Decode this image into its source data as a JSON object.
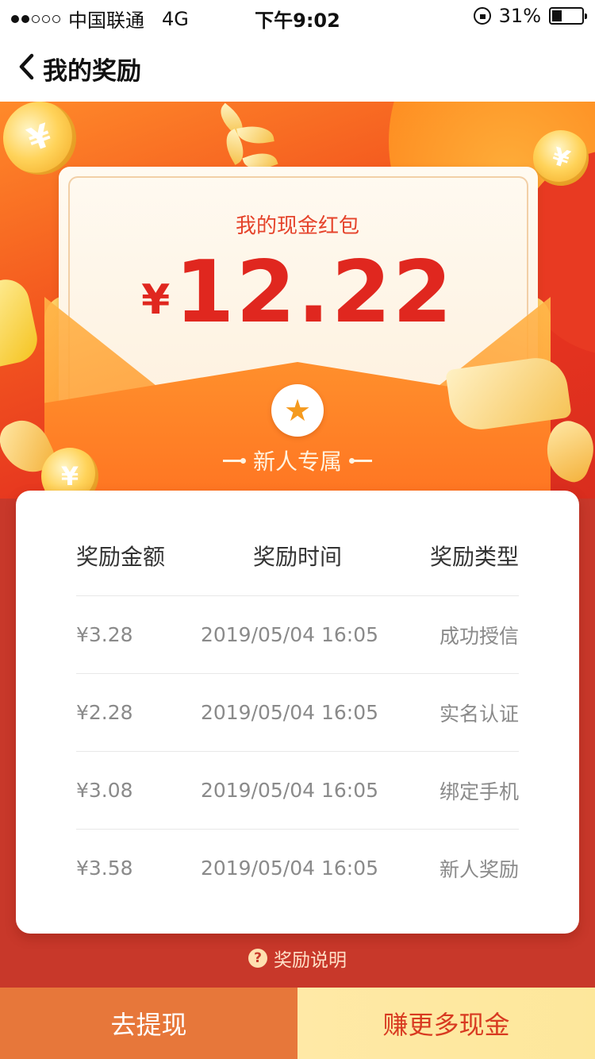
{
  "status_bar": {
    "carrier": "中国联通",
    "network": "4G",
    "time": "下午9:02",
    "battery": "31%"
  },
  "nav": {
    "title": "我的奖励",
    "back_icon": "chevron-left-icon"
  },
  "hero": {
    "card_title": "我的现金红包",
    "currency": "¥",
    "amount": "12.22",
    "badge": "新人专属",
    "star_icon": "star-icon",
    "colors": {
      "accent": "#e0271f",
      "envelope": "#ff8a2a",
      "coin": "#ffd35a"
    }
  },
  "table": {
    "headers": [
      "奖励金额",
      "奖励时间",
      "奖励类型"
    ],
    "rows": [
      {
        "amount": "¥3.28",
        "time": "2019/05/04 16:05",
        "type": "成功授信"
      },
      {
        "amount": "¥2.28",
        "time": "2019/05/04 16:05",
        "type": "实名认证"
      },
      {
        "amount": "¥3.08",
        "time": "2019/05/04 16:05",
        "type": "绑定手机"
      },
      {
        "amount": "¥3.58",
        "time": "2019/05/04 16:05",
        "type": "新人奖励"
      }
    ]
  },
  "help": {
    "icon": "question-circle-icon",
    "label": "奖励说明"
  },
  "buttons": {
    "withdraw": "去提现",
    "earn_more": "赚更多现金"
  }
}
